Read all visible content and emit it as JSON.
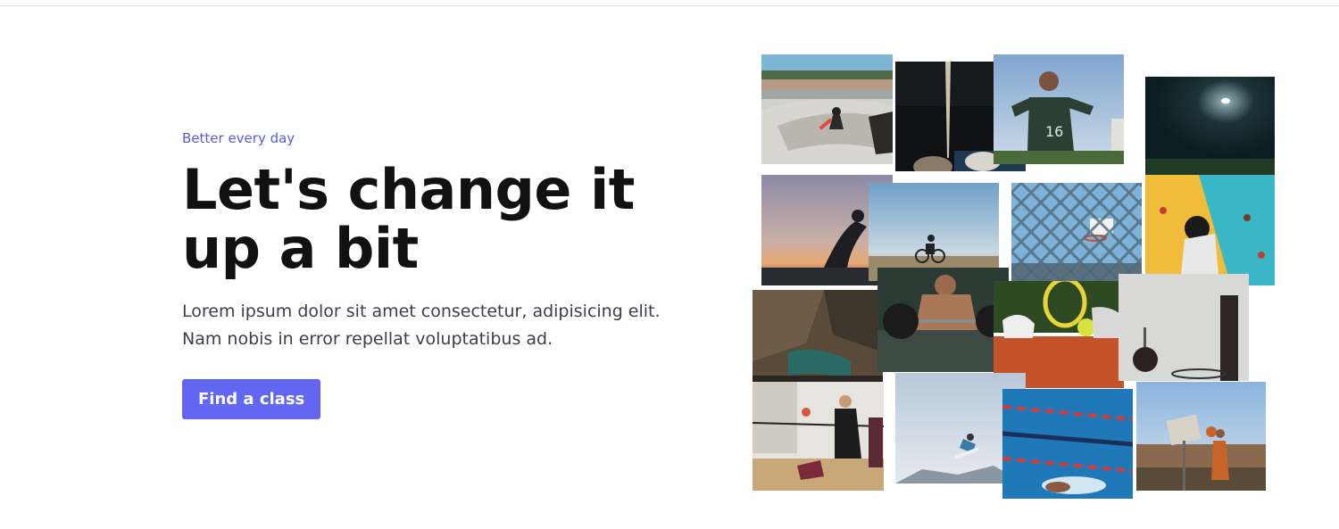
{
  "hero": {
    "eyebrow": "Better every day",
    "headline": "Let's change it up a bit",
    "body": "Lorem ipsum dolor sit amet consectetur, adipisicing elit. Nam nobis in error repellat voluptatibus ad.",
    "cta_label": "Find a class"
  },
  "collage": {
    "tiles": [
      {
        "name": "skatepark-photo"
      },
      {
        "name": "pole-vault-photo"
      },
      {
        "name": "soccer-player-photo"
      },
      {
        "name": "night-field-photo"
      },
      {
        "name": "yoga-sunset-photo"
      },
      {
        "name": "cyclist-photo"
      },
      {
        "name": "basketball-fence-photo"
      },
      {
        "name": "climbing-wall-photo"
      },
      {
        "name": "rock-shoes-photo"
      },
      {
        "name": "weightlifting-photo"
      },
      {
        "name": "tennis-photo"
      },
      {
        "name": "basketball-hoop-photo"
      },
      {
        "name": "volleyball-photo"
      },
      {
        "name": "snowboard-photo"
      },
      {
        "name": "swimming-photo"
      },
      {
        "name": "streetball-photo"
      }
    ]
  },
  "colors": {
    "accent": "#6366f1",
    "eyebrow": "#5b5bd6",
    "headline": "#111111",
    "body": "#3a3f4b"
  }
}
